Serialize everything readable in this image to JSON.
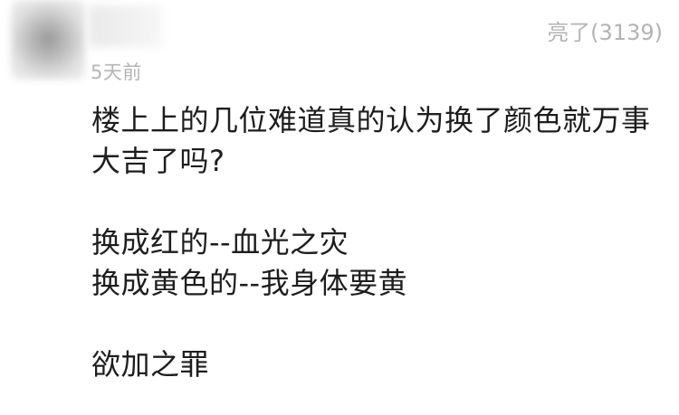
{
  "comment": {
    "timestamp": "5天前",
    "likes_label": "亮了(3139)",
    "text_lines": [
      "楼上上的几位难道真的认为换了颜色就万事",
      "大吉了吗?",
      "",
      "换成红的--血光之灾",
      "换成黄色的--我身体要黄",
      "",
      "欲加之罪"
    ]
  }
}
